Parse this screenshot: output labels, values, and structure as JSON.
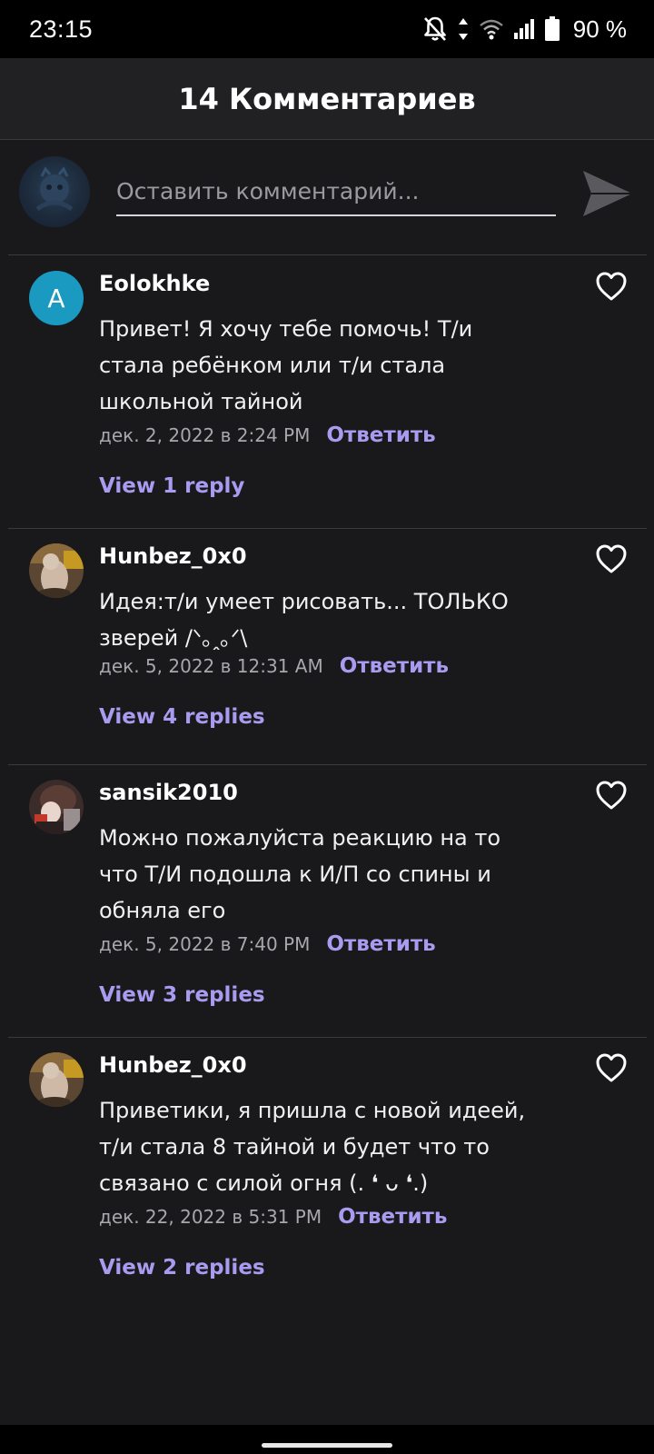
{
  "status_bar": {
    "time": "23:15",
    "battery": "90 %",
    "icons": [
      "bell-off-icon",
      "data-arrows-icon",
      "wifi-icon",
      "signal-icon",
      "battery-icon"
    ]
  },
  "header": {
    "title": "14 Комментариев"
  },
  "composer": {
    "placeholder": "Оставить комментарий...",
    "send_icon": "send-icon"
  },
  "comments": [
    {
      "author": "Eolokhke",
      "avatar_letter": "A",
      "text": "Привет! Я  хочу тебе помочь! Т/и стала ребёнком или т/и стала школьной тайной",
      "date": "дек. 2, 2022 в 2:24 PM",
      "reply_label": "Ответить",
      "replies_label": "View 1 reply"
    },
    {
      "author": "Hunbez_0x0",
      "text": "Идея:т/и умеет рисовать... ТОЛЬКО зверей /ᐠ｡ꞈ｡ᐟ\\",
      "date": "дек. 5, 2022 в 12:31 AM",
      "reply_label": "Ответить",
      "replies_label": "View 4 replies"
    },
    {
      "author": "sansik2010",
      "text": "Можно пожалуйста реакцию на то что Т/И подошла к И/П со спины и обняла его",
      "date": "дек. 5, 2022 в 7:40 PM",
      "reply_label": "Ответить",
      "replies_label": "View 3 replies"
    },
    {
      "author": "Hunbez_0x0",
      "text": "Приветики, я пришла с новой идеей, т/и стала 8 тайной и будет что то связано с силой огня (. ❛ ᴗ ❛.)",
      "date": "дек. 22, 2022 в 5:31 PM",
      "reply_label": "Ответить",
      "replies_label": "View 2 replies"
    }
  ],
  "colors": {
    "background": "#19181b",
    "header_bg": "#212023",
    "accent": "#a99cf0",
    "avatar_blue": "#1a9ac0"
  }
}
